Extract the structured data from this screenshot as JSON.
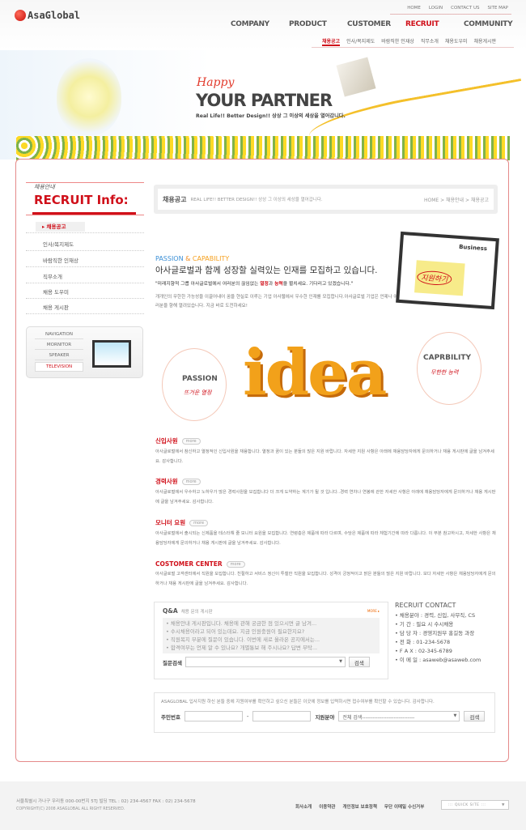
{
  "header": {
    "logo": "AsaGlobal",
    "util_links": [
      "HOME",
      "LOGIN",
      "CONTACT US",
      "SITE MAP"
    ],
    "gnav": [
      "COMPANY",
      "PRODUCT",
      "CUSTOMER",
      "RECRUIT",
      "COMMUNITY"
    ],
    "gnav_active": "RECRUIT",
    "subnav": [
      "채용공고",
      "인사/복지제도",
      "바람직한 인재상",
      "직무소개",
      "채용도우미",
      "채용게시판"
    ]
  },
  "banner": {
    "happy": "Happy",
    "title": "YOUR PARTNER",
    "tagline": "Real Life!! Better Design!! 상상 그 이상의 세상을 열어갑니다."
  },
  "sidebar": {
    "small_title": "채용안내",
    "title": "RECRUIT Info:",
    "items": [
      "채용공고",
      "인사/복지제도",
      "바람직한 인재상",
      "직무소개",
      "채용 도우미",
      "채용 게시판"
    ],
    "nav_box": [
      "NAVIGATION",
      "MORNITOR",
      "SPEAKER",
      "TELEVISION"
    ]
  },
  "crumb": {
    "title": "채용공고",
    "subtitle": "REAL LIFE!! BETTER DESIGN!!  상상 그 이상의 세상을 열어갑니다.",
    "path": "HOME > 채용안내 > 채용공고"
  },
  "intro": {
    "pc_passion": "PASSION",
    "pc_amp": " & ",
    "pc_capability": "CAPABILITY",
    "headline": "아사글로벌과 함께 성장할 실력있는 인재를 모집하고 있습니다.",
    "quote_a": "\"미래지향적 그룹 아사글로벌에서 여러분의 끊임없는 ",
    "quote_b": "열정",
    "quote_c": "과 ",
    "quote_d": "능력",
    "quote_e": "을 펼치세요. 기다리고 있겠습니다.\"",
    "desc": "개개인의 무한한 가능성을 이끌어내어 꿈을 현실로 이루는 기업 아사웹에서 우수한  인재를 모집합니다.아사글로벌 기업은 언제나 여러분을 향해 열려있습니다.  지금 바로 도전하세요!",
    "business_label": "Business",
    "apply_stamp": "지원하기"
  },
  "idea": {
    "word": "idea",
    "passion": "PASSION",
    "passion_ko": "뜨거운 열정",
    "capability": "CAPRBILITY",
    "capability_ko": "무한한 능력"
  },
  "jobs": [
    {
      "title": "신입사원",
      "more": "more",
      "text": "아사글로벌에서 참신하고 열정적인  신입사원을 채용합니다. 열정과 꿈이 있는 분들의 많은 지원 바랍니다. 자세한 지원 사항은 아래에 채용담당자에게 문의하거나 채용 게시판에 글을 남겨주세요.  감사합니다."
    },
    {
      "title": "경력사원",
      "more": "more",
      "text": "아사글로벌에서 우수하고 노하우가 많은 경력사원을 모집합니다  더 크게 도약하는 계기가 될 것 입니다..경력 연차나 연봉에 관한 자세한 사항은 아래에 채용담당자에게 문의하거나 채용 게시판에 글을 남겨주세요. 감사합니다."
    },
    {
      "title": "모니터 요원",
      "more": "more",
      "text": "아사글로벌에서 출시되는 신제품을 테스터해 줄 모니터 요원을 모집합니다. 연령층은 제품에 따라 다르며, 수당은 제품에 따라 체험기간에 따라 다릅니다. 이 부분 참고하시고, 자세한 사항은 채용담당자에게 문의하거나 채용 게시판에 글을 남겨주세요. 감사합니다."
    },
    {
      "title": "COSTOMER CENTER",
      "more": "more",
      "text": "아사글로벌 고객센터에서 직원을 모집합니다. 친절하고 서비스 정신이 투철한 직원을 모집합니다. 성격이 긍정적이고 밝은 분들의 많은 지원 바랍니다.  보다 자세한 사항은 채용담당자에게 문의하거나 채용 게시판에 글을 남겨주세요. 감사합니다."
    }
  ],
  "qa": {
    "title": "Q&A",
    "subtitle": "채용 문의 게시판",
    "more": "MORE ▸",
    "posts": [
      "채용안내 게시판입니다. 채용에 관해 궁금한 점 있으시면 글 남겨...",
      "수시채용이라고 되어 있는데요. 지금 인원충원이 필요한지요?",
      "직원복지 부분에 질문이 있습니다. 이번에 새로 올라온 공지에서는...",
      "합격여부는 언제 알 수 있나요? 개별통보 해 주시나요? 답변 부탁..."
    ],
    "search_label": "질문검색",
    "search_button": "검색"
  },
  "contact": {
    "title": "RECRUIT CONTACT",
    "rows": [
      "채용분야 : 경력, 신입, 사무직, CS",
      "기     간 : 필요 시 수시채용",
      "담 당 자 : 경영지원부 홍길동 과장",
      "전     화 : 01-234-5678",
      "F  A  X : 02-345-6789",
      "이 메 일 : asaweb@asaweb.com"
    ]
  },
  "apply": {
    "text": "ASAGLOBAL 입사지원 하신 분들 중에 지원여부를 확인하고 싶으신 분들은 이곳에 정보를 입력하시면 접수여부를 확인할 수 있습니다. 감사합니다.",
    "id_label": "주민번호",
    "dash": "-",
    "field_label": "지원분야",
    "field_value": "전체 검색------------------------------",
    "button": "검색"
  },
  "footer": {
    "address": "서울특별시 가나구 우리동 000-00번지 5TJ 빌딩  TEL : 02) 234-4567  FAX : 02) 234-5678",
    "copyright": "COPYRIGHT(C) 2008 ASAGLOBAL  ALL RIGHT RESERVED.",
    "links": [
      "회사소개",
      "이용약관",
      "개인정보 보호정책",
      "무단 이메일 수신거부"
    ],
    "quick_site": "::: QUICK SITE :::"
  },
  "colors": {
    "accent": "#d0101a",
    "border": "#e58a8a",
    "idea": "#f2a11a"
  }
}
